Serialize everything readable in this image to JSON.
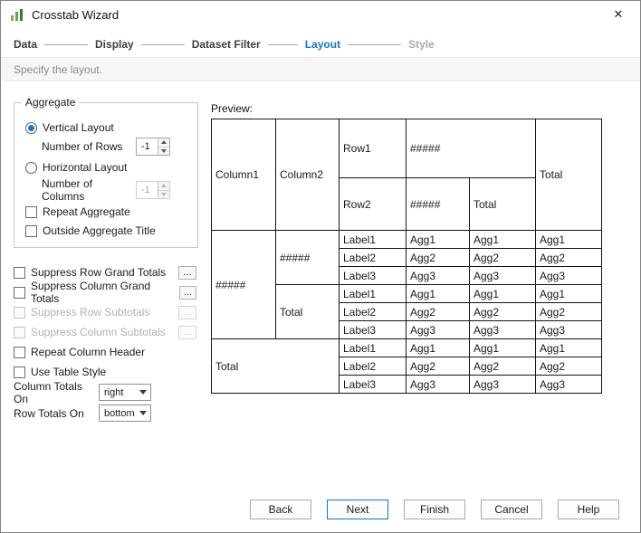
{
  "window": {
    "title": "Crosstab Wizard",
    "close_icon": "✕"
  },
  "steps": {
    "items": [
      {
        "label": "Data",
        "state": "normal"
      },
      {
        "label": "Display",
        "state": "normal"
      },
      {
        "label": "Dataset Filter",
        "state": "normal"
      },
      {
        "label": "Layout",
        "state": "active"
      },
      {
        "label": "Style",
        "state": "upcoming"
      }
    ]
  },
  "subtitle": "Specify the layout.",
  "aggregate": {
    "legend": "Aggregate",
    "vertical_label": "Vertical Layout",
    "vertical_sub": "Number of Rows",
    "vertical_value": "-1",
    "vertical_selected": true,
    "horizontal_label": "Horizontal Layout",
    "horizontal_sub": "Number of Columns",
    "horizontal_value": "-1",
    "horizontal_selected": false,
    "repeat_label": "Repeat Aggregate",
    "repeat_checked": false,
    "outside_label": "Outside Aggregate Title",
    "outside_checked": false
  },
  "options": [
    {
      "label": "Suppress Row Grand Totals",
      "checked": false,
      "disabled": false,
      "more": "…"
    },
    {
      "label": "Suppress Column Grand Totals",
      "checked": false,
      "disabled": false,
      "more": "…"
    },
    {
      "label": "Suppress Row Subtotals",
      "checked": false,
      "disabled": true,
      "more": "…"
    },
    {
      "label": "Suppress Column Subtotals",
      "checked": false,
      "disabled": true,
      "more": "…"
    },
    {
      "label": "Repeat Column Header",
      "checked": false,
      "disabled": false
    },
    {
      "label": "Use Table Style",
      "checked": false,
      "disabled": false
    }
  ],
  "column_totals": {
    "label": "Column Totals On",
    "value": "right"
  },
  "row_totals": {
    "label": "Row Totals On",
    "value": "bottom"
  },
  "preview": {
    "label": "Preview:",
    "column1": "Column1",
    "column2": "Column2",
    "row1": "Row1",
    "row1_agg": "#####",
    "row2": "Row2",
    "row2_agg": "#####",
    "row2_total": "Total",
    "right_total": "Total",
    "row_group": "#####",
    "col_group": "#####",
    "col_total": "Total",
    "grand_total": "Total",
    "label1": "Label1",
    "label2": "Label2",
    "label3": "Label3",
    "agg1": "Agg1",
    "agg2": "Agg2",
    "agg3": "Agg3"
  },
  "buttons": [
    {
      "label": "Back"
    },
    {
      "label": "Next",
      "default": true
    },
    {
      "label": "Finish"
    },
    {
      "label": "Cancel"
    },
    {
      "label": "Help"
    }
  ],
  "colors": {
    "accent_blue": "#1878c8",
    "default_button_border": "#0078d7",
    "icon_green": "#3f9c35"
  }
}
